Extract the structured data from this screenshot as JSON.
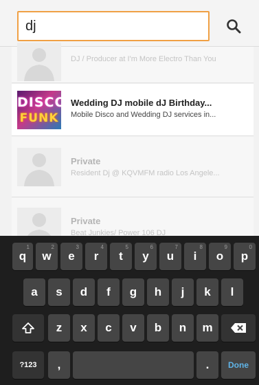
{
  "search": {
    "query": "dj",
    "button_icon": "search-icon"
  },
  "results": [
    {
      "title": "",
      "subtitle": "DJ / Producer at I'm More Electro Than You",
      "avatar": "placeholder-person",
      "muted": true
    },
    {
      "title": "Wedding DJ mobile dJ Birthday...",
      "subtitle": "Mobile Disco and Wedding DJ services in...",
      "avatar": "disco-funk",
      "muted": false,
      "avatar_text": [
        "DISCO",
        "FUNK"
      ]
    },
    {
      "title": "Private",
      "subtitle": "Resident Dj @ KQVMFM radio Los Angele...",
      "avatar": "placeholder-person",
      "muted": true
    },
    {
      "title": "Private",
      "subtitle": "Beat Junkies/ Power 106 DJ",
      "avatar": "placeholder-person",
      "muted": true
    }
  ],
  "keyboard": {
    "row1": [
      "q",
      "w",
      "e",
      "r",
      "t",
      "y",
      "u",
      "i",
      "o",
      "p"
    ],
    "row1_hints": [
      "1",
      "2",
      "3",
      "4",
      "5",
      "6",
      "7",
      "8",
      "9",
      "0"
    ],
    "row2": [
      "a",
      "s",
      "d",
      "f",
      "g",
      "h",
      "j",
      "k",
      "l"
    ],
    "row3": [
      "z",
      "x",
      "c",
      "v",
      "b",
      "n",
      "m"
    ],
    "symbols_label": "?123",
    "comma": ",",
    "period": ".",
    "done_label": "Done"
  },
  "colors": {
    "search_border": "#f0a044",
    "done_text": "#5fb4e8"
  }
}
